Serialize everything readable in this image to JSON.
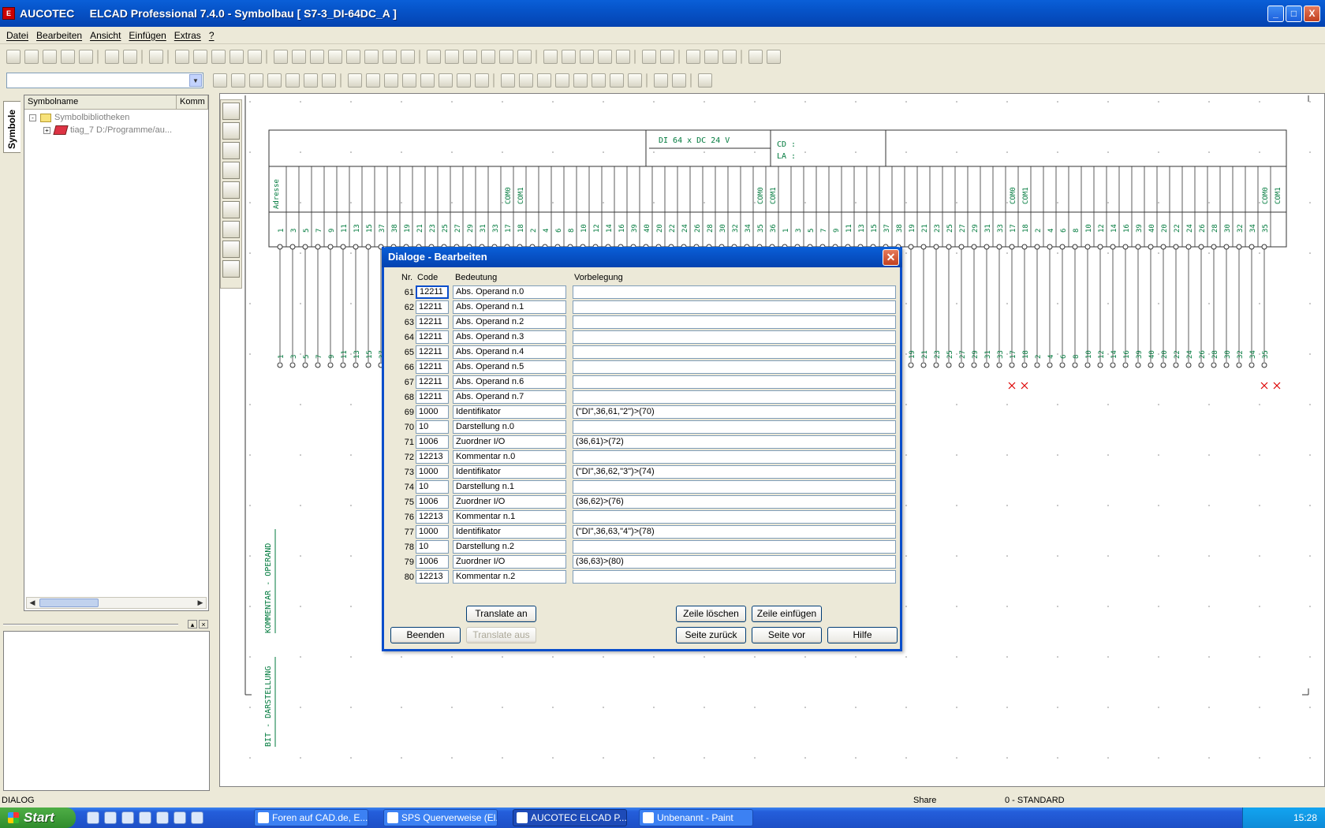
{
  "window": {
    "app_icon": "elcad-app-icon",
    "title": "AUCOTEC     ELCAD Professional 7.4.0 - Symbolbau [ S7-3_DI-64DC_A ]",
    "controls": [
      "_",
      "□",
      "X"
    ]
  },
  "menu": [
    "Datei",
    "Bearbeiten",
    "Ansicht",
    "Einfügen",
    "Extras",
    "?"
  ],
  "left_panel": {
    "tab_label": "Symbole",
    "columns": [
      "Symbolname",
      "Komm"
    ],
    "tree": [
      {
        "expander": "-",
        "icon": "folder-icon",
        "label": "Symbolbibliotheken"
      },
      {
        "expander": "+",
        "icon": "library-icon",
        "label": "tiag_7   D:/Programme/au..."
      }
    ]
  },
  "drawing": {
    "header_left": "DI 64 x DC 24 V",
    "cd_label": "CD :",
    "la_label": "LA :",
    "address_label": "Adresse",
    "com_labels": [
      "COM0",
      "COM1"
    ],
    "side_label_1": "KOMMENTAR - OPERAND",
    "side_label_2": "BIT - DARSTELLUNG",
    "terminal_numbers": [
      "1",
      "3",
      "5",
      "7",
      "9",
      "11",
      "13",
      "15",
      "37",
      "38",
      "19",
      "21",
      "23",
      "25",
      "27",
      "29",
      "31",
      "33",
      "17",
      "18",
      "2",
      "4",
      "6",
      "8",
      "10",
      "12",
      "14",
      "16",
      "39",
      "40",
      "20",
      "22",
      "24",
      "26",
      "28",
      "30",
      "32",
      "34",
      "35",
      "36"
    ]
  },
  "dialog": {
    "title": "Dialoge - Bearbeiten",
    "columns": {
      "nr": "Nr.",
      "code": "Code",
      "bedeutung": "Bedeutung",
      "vorbelegung": "Vorbelegung"
    },
    "rows": [
      {
        "nr": "61",
        "code": "12211",
        "bedeutung": "Abs. Operand n.0",
        "vorbelegung": ""
      },
      {
        "nr": "62",
        "code": "12211",
        "bedeutung": "Abs. Operand n.1",
        "vorbelegung": ""
      },
      {
        "nr": "63",
        "code": "12211",
        "bedeutung": "Abs. Operand n.2",
        "vorbelegung": ""
      },
      {
        "nr": "64",
        "code": "12211",
        "bedeutung": "Abs. Operand n.3",
        "vorbelegung": ""
      },
      {
        "nr": "65",
        "code": "12211",
        "bedeutung": "Abs. Operand n.4",
        "vorbelegung": ""
      },
      {
        "nr": "66",
        "code": "12211",
        "bedeutung": "Abs. Operand n.5",
        "vorbelegung": ""
      },
      {
        "nr": "67",
        "code": "12211",
        "bedeutung": "Abs. Operand n.6",
        "vorbelegung": ""
      },
      {
        "nr": "68",
        "code": "12211",
        "bedeutung": "Abs. Operand n.7",
        "vorbelegung": ""
      },
      {
        "nr": "69",
        "code": "1000",
        "bedeutung": "Identifikator",
        "vorbelegung": "(\"DI\",36,61,\"2\")>(70)"
      },
      {
        "nr": "70",
        "code": "10",
        "bedeutung": "Darstellung n.0",
        "vorbelegung": ""
      },
      {
        "nr": "71",
        "code": "1006",
        "bedeutung": "Zuordner I/O",
        "vorbelegung": "(36,61)>(72)"
      },
      {
        "nr": "72",
        "code": "12213",
        "bedeutung": "Kommentar n.0",
        "vorbelegung": ""
      },
      {
        "nr": "73",
        "code": "1000",
        "bedeutung": "Identifikator",
        "vorbelegung": "(\"DI\",36,62,\"3\")>(74)"
      },
      {
        "nr": "74",
        "code": "10",
        "bedeutung": "Darstellung n.1",
        "vorbelegung": ""
      },
      {
        "nr": "75",
        "code": "1006",
        "bedeutung": "Zuordner I/O",
        "vorbelegung": "(36,62)>(76)"
      },
      {
        "nr": "76",
        "code": "12213",
        "bedeutung": "Kommentar n.1",
        "vorbelegung": ""
      },
      {
        "nr": "77",
        "code": "1000",
        "bedeutung": "Identifikator",
        "vorbelegung": "(\"DI\",36,63,\"4\")>(78)"
      },
      {
        "nr": "78",
        "code": "10",
        "bedeutung": "Darstellung n.2",
        "vorbelegung": ""
      },
      {
        "nr": "79",
        "code": "1006",
        "bedeutung": "Zuordner I/O",
        "vorbelegung": "(36,63)>(80)"
      },
      {
        "nr": "80",
        "code": "12213",
        "bedeutung": "Kommentar n.2",
        "vorbelegung": ""
      }
    ],
    "buttons": {
      "translate_an": "Translate an",
      "zeile_loeschen": "Zeile löschen",
      "zeile_einfuegen": "Zeile einfügen",
      "beenden": "Beenden",
      "translate_aus": "Translate aus",
      "seite_zurueck": "Seite zurück",
      "seite_vor": "Seite vor",
      "hilfe": "Hilfe"
    }
  },
  "status": {
    "left": "DIALOG",
    "share": "Share",
    "layer": "0 - STANDARD"
  },
  "taskbar": {
    "start": "Start",
    "tasks": [
      "Foren auf CAD.de, E...",
      "SPS Querverweise (El...",
      "AUCOTEC     ELCAD P...",
      "Unbenannt - Paint"
    ],
    "clock": "15:28"
  },
  "colors": {
    "accent": "#0a4ecb",
    "drawing_line": "#007a3d",
    "titlebar": "#0653c8"
  }
}
